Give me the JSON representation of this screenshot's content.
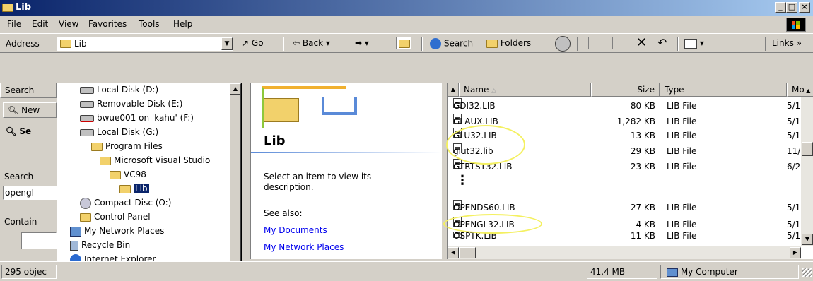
{
  "window": {
    "title": "Lib"
  },
  "menu": [
    "File",
    "Edit",
    "View",
    "Favorites",
    "Tools",
    "Help"
  ],
  "address": {
    "label": "Address",
    "value": "Lib",
    "go": "Go"
  },
  "toolbar": {
    "back": "Back",
    "search": "Search",
    "folders": "Folders",
    "links": "Links"
  },
  "left_pane": {
    "search_header": "Search",
    "new_label": "New",
    "search_label": "Search",
    "search_value": "opengl",
    "contain_label": "Contain",
    "status_count": "295 objec"
  },
  "dropdown": {
    "items": [
      {
        "label": "Local Disk (D:)"
      },
      {
        "label": "Removable Disk (E:)"
      },
      {
        "label": "bwue001 on 'kahu' (F:)"
      },
      {
        "label": "Local Disk (G:)"
      },
      {
        "label": "Program Files"
      },
      {
        "label": "Microsoft Visual Studio"
      },
      {
        "label": "VC98"
      },
      {
        "label": "Lib"
      },
      {
        "label": "Compact Disc (O:)"
      },
      {
        "label": "Control Panel"
      },
      {
        "label": "My Network Places"
      },
      {
        "label": "Recycle Bin"
      },
      {
        "label": "Internet Explorer"
      }
    ]
  },
  "middle": {
    "folder_title": "Lib",
    "description": "Select an item to view its description.",
    "see_also": "See also:",
    "links": [
      "My Documents",
      "My Network Places"
    ]
  },
  "list": {
    "columns": [
      "Name",
      "Size",
      "Type",
      "Mo"
    ],
    "rows": [
      {
        "name": "GDI32.LIB",
        "size": "80 KB",
        "type": "LIB File",
        "mod": "5/1"
      },
      {
        "name": "GLAUX.LIB",
        "size": "1,282 KB",
        "type": "LIB File",
        "mod": "5/1"
      },
      {
        "name": "GLU32.LIB",
        "size": "13 KB",
        "type": "LIB File",
        "mod": "5/1"
      },
      {
        "name": "glut32.lib",
        "size": "29 KB",
        "type": "LIB File",
        "mod": "11/"
      },
      {
        "name": "GTRTST32.LIB",
        "size": "23 KB",
        "type": "LIB File",
        "mod": "6/2"
      },
      {
        "name": "OPENDS60.LIB",
        "size": "27 KB",
        "type": "LIB File",
        "mod": "5/1"
      },
      {
        "name": "OPENGL32.LIB",
        "size": "4 KB",
        "type": "LIB File",
        "mod": "5/1"
      },
      {
        "name": "OSPTK.LIB",
        "size": "11 KB",
        "type": "LIB File",
        "mod": "5/1"
      }
    ],
    "ellipsis": "⋮"
  },
  "status": {
    "size": "41.4 MB",
    "zone": "My Computer"
  },
  "colors": {
    "title_start": "#0a246a",
    "title_end": "#a6caf0",
    "highlight": "#f4f060",
    "link": "#0000ee"
  },
  "icons": [
    "folder-icon",
    "drive-icon",
    "network-drive-icon",
    "cd-icon",
    "control-panel-icon",
    "network-places-icon",
    "recycle-bin-icon",
    "internet-explorer-icon",
    "lib-file-icon",
    "search-icon",
    "folders-icon",
    "back-arrow-icon",
    "forward-arrow-icon",
    "up-folder-icon",
    "history-icon",
    "views-icon",
    "windows-logo-icon",
    "computer-icon"
  ]
}
